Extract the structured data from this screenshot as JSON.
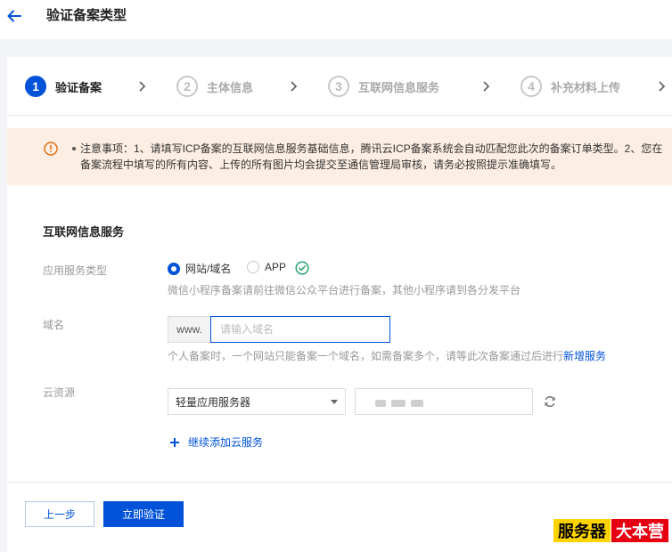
{
  "header": {
    "title": "验证备案类型"
  },
  "steps": [
    {
      "num": "1",
      "label": "验证备案"
    },
    {
      "num": "2",
      "label": "主体信息"
    },
    {
      "num": "3",
      "label": "互联网信息服务"
    },
    {
      "num": "4",
      "label": "补充材料上传"
    }
  ],
  "notice": {
    "text": "注意事项：1、请填写ICP备案的互联网信息服务基础信息，腾讯云ICP备案系统会自动匹配您此次的备案订单类型。2、您在备案流程中填写的所有内容、上传的所有图片均会提交至通信管理局审核，请务必按照提示准确填写。"
  },
  "form": {
    "section_title": "互联网信息服务",
    "service_type": {
      "label": "应用服务类型",
      "options": [
        "网站/域名",
        "APP"
      ],
      "selected": "网站/域名",
      "hint": "微信小程序备案请前往微信公众平台进行备案，其他小程序请到各分发平台"
    },
    "domain": {
      "label": "域名",
      "prefix": "www.",
      "value": "",
      "placeholder": "请输入域名",
      "hint": "个人备案时，一个网站只能备案一个域名，如需备案多个，请等此次备案通过后进行",
      "hint_link": "新增服务"
    },
    "cloud": {
      "label": "云资源",
      "select_value": "轻量应用服务器",
      "add_label": "继续添加云服务"
    }
  },
  "actions": {
    "prev": "上一步",
    "verify": "立即验证"
  },
  "watermark": {
    "part1": "服务器",
    "part2": "大本营"
  },
  "colors": {
    "primary": "#0052d9",
    "notice_bg": "#fdeee3",
    "warning": "#e37318",
    "success": "#2ba471"
  }
}
